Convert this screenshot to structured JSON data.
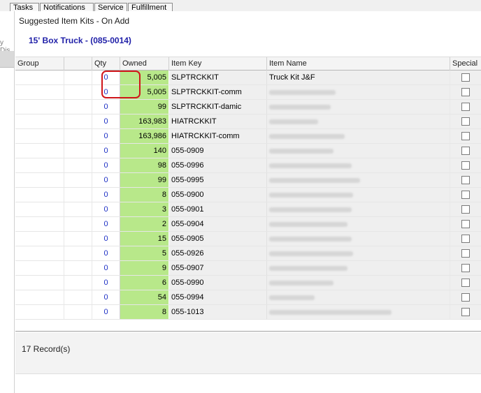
{
  "background_tabs": [
    "Tasks",
    "Notifications",
    "Service",
    "Fulfillment"
  ],
  "background_side_label": "y Dis",
  "dialog": {
    "title": "Suggested Item Kits - On Add",
    "subtitle": "15' Box Truck  - (085-0014)"
  },
  "grid": {
    "columns": [
      "Group",
      "",
      "Qty",
      "Owned",
      "Item Key",
      "Item Name",
      "Special"
    ],
    "rows": [
      {
        "qty": "0",
        "owned": "5,005",
        "item_key": "SLPTRCKKIT",
        "item_name": "Truck Kit J&F",
        "special": false
      },
      {
        "qty": "0",
        "owned": "5,005",
        "item_key": "SLPTRCKKIT-comm",
        "item_name": "",
        "special": false
      },
      {
        "qty": "0",
        "owned": "99",
        "item_key": "SLPTRCKKIT-damic",
        "item_name": "",
        "special": false
      },
      {
        "qty": "0",
        "owned": "163,983",
        "item_key": "HIATRCKKIT",
        "item_name": "",
        "special": false
      },
      {
        "qty": "0",
        "owned": "163,986",
        "item_key": "HIATRCKKIT-comm",
        "item_name": "",
        "special": false
      },
      {
        "qty": "0",
        "owned": "140",
        "item_key": "055-0909",
        "item_name": "",
        "special": false
      },
      {
        "qty": "0",
        "owned": "98",
        "item_key": "055-0996",
        "item_name": "",
        "special": false
      },
      {
        "qty": "0",
        "owned": "99",
        "item_key": "055-0995",
        "item_name": "",
        "special": false
      },
      {
        "qty": "0",
        "owned": "8",
        "item_key": "055-0900",
        "item_name": "",
        "special": false
      },
      {
        "qty": "0",
        "owned": "3",
        "item_key": "055-0901",
        "item_name": "",
        "special": false
      },
      {
        "qty": "0",
        "owned": "2",
        "item_key": "055-0904",
        "item_name": "",
        "special": false
      },
      {
        "qty": "0",
        "owned": "15",
        "item_key": "055-0905",
        "item_name": "",
        "special": false
      },
      {
        "qty": "0",
        "owned": "5",
        "item_key": "055-0926",
        "item_name": "",
        "special": false
      },
      {
        "qty": "0",
        "owned": "9",
        "item_key": "055-0907",
        "item_name": "",
        "special": false
      },
      {
        "qty": "0",
        "owned": "6",
        "item_key": "055-0990",
        "item_name": "",
        "special": false
      },
      {
        "qty": "0",
        "owned": "54",
        "item_key": "055-0994",
        "item_name": "",
        "special": false
      },
      {
        "qty": "0",
        "owned": "8",
        "item_key": "055-1013",
        "item_name": "",
        "special": false
      }
    ]
  },
  "footer": {
    "records_label": "17 Record(s)"
  },
  "colors": {
    "owned_fill": "#b8e88a",
    "qty_text": "#1c2fc4",
    "subtitle_text": "#1f1fa8",
    "highlight": "#d0161b"
  }
}
